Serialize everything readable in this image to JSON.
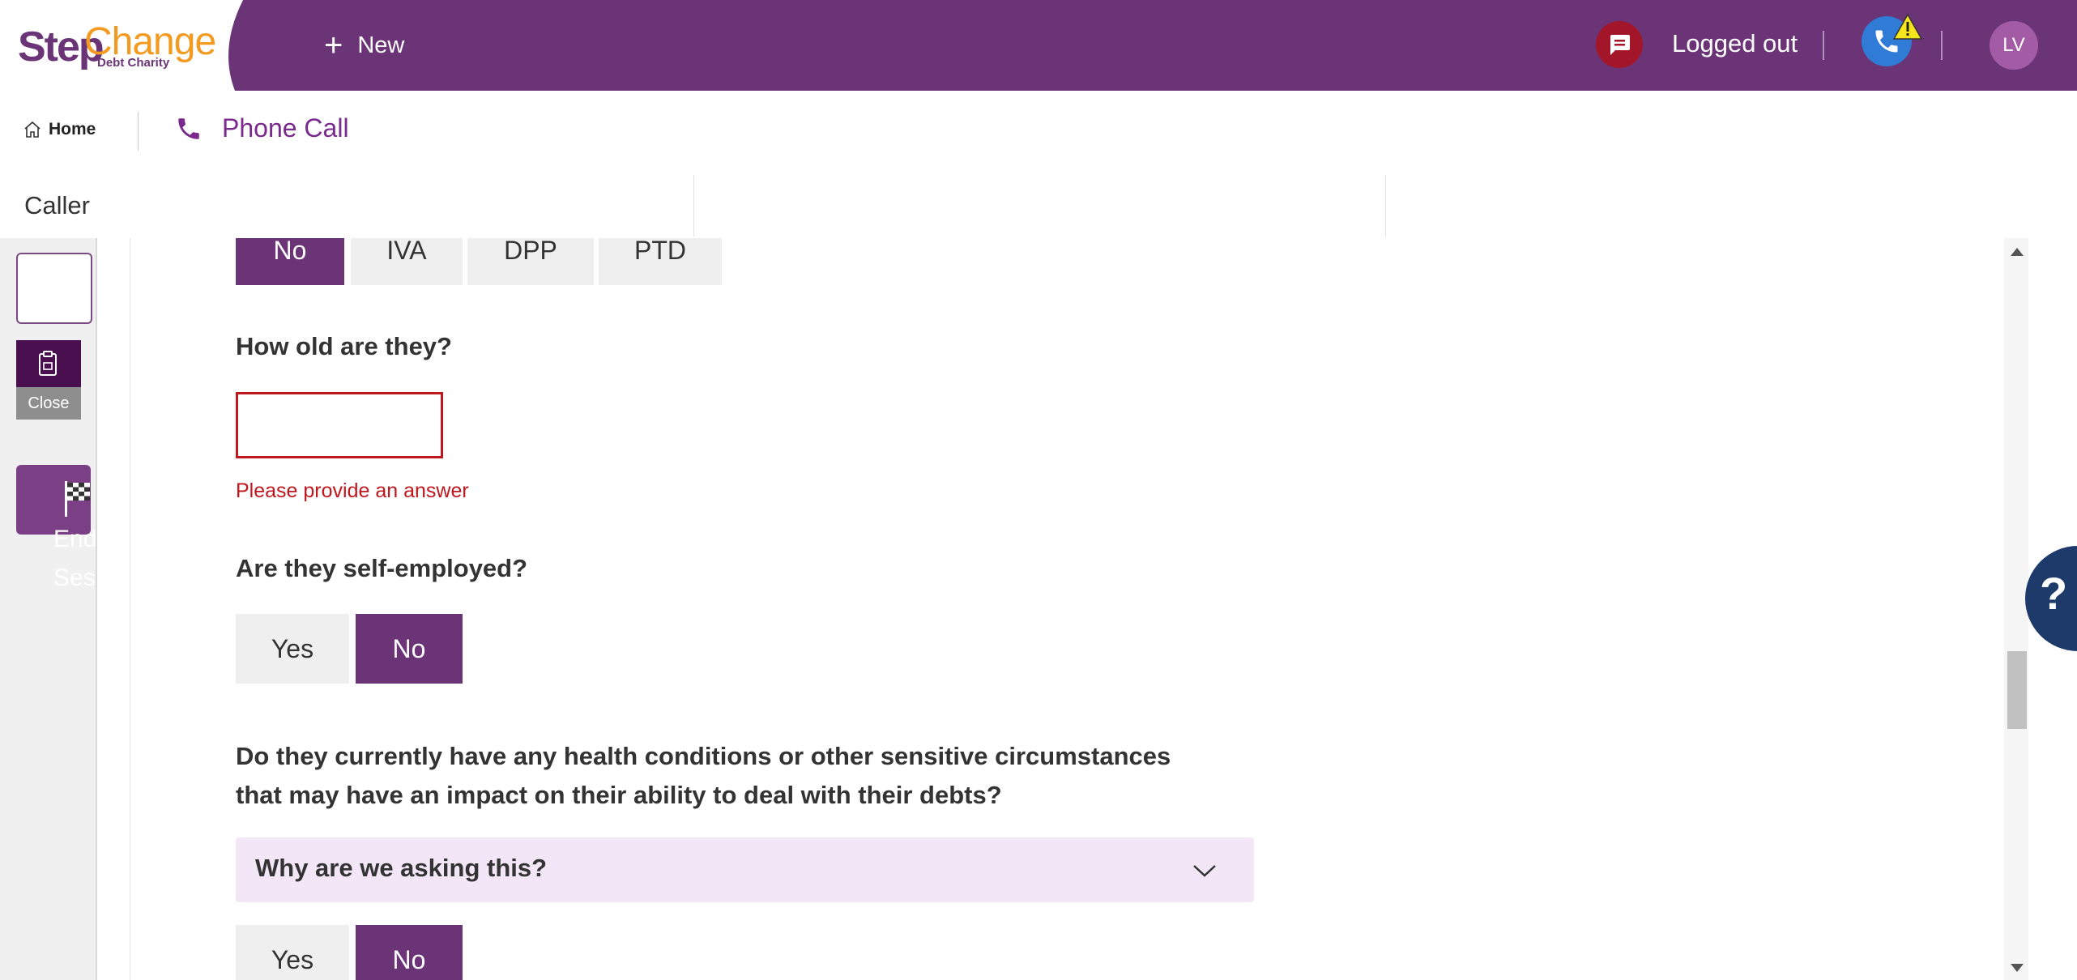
{
  "header": {
    "logo_step": "Step",
    "logo_change": "Change",
    "logo_sub": "Debt Charity",
    "new_label": "New",
    "status_label": "Logged out",
    "avatar_initials": "LV"
  },
  "breadcrumb": {
    "home_label": "Home",
    "current_label": "Phone Call"
  },
  "caller": {
    "label": "Caller"
  },
  "rail": {
    "close_label": "Close",
    "end_session_label": "End Session"
  },
  "form": {
    "prev_options": [
      "No",
      "IVA",
      "DPP",
      "PTD"
    ],
    "prev_selected": "No",
    "age_question": "How old are they?",
    "age_value": "",
    "age_error": "Please provide an answer",
    "self_employed_question": "Are they self-employed?",
    "self_employed_options": [
      "Yes",
      "No"
    ],
    "self_employed_selected": "No",
    "health_question_line1": "Do they currently have any health conditions or other sensitive circumstances",
    "health_question_line2": "that may have an impact on their ability to deal with their debts?",
    "why_label": "Why are we asking this?",
    "health_options": [
      "Yes",
      "No"
    ],
    "health_selected": "No"
  },
  "help": {
    "label": "?"
  },
  "colors": {
    "brand": "#6b3477",
    "accent": "#f39a21",
    "error": "#c0161d",
    "chat": "#a3162a",
    "phone": "#2f7bd6"
  }
}
